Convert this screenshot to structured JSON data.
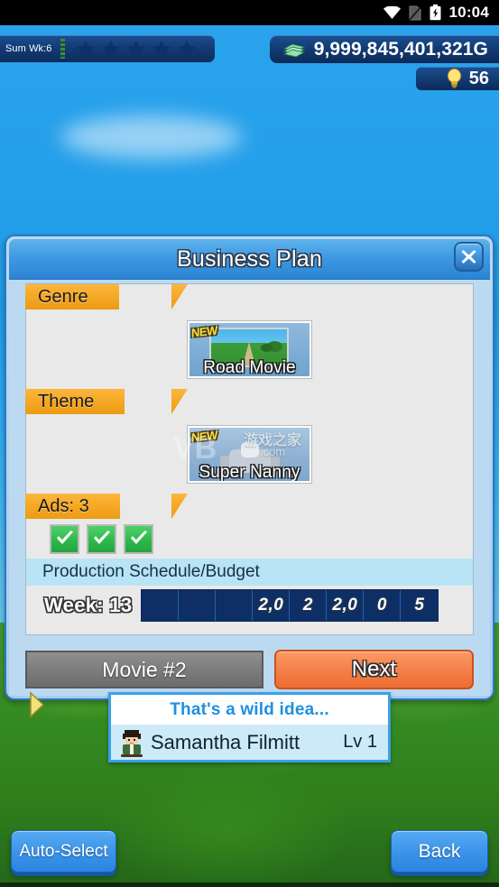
{
  "status_bar": {
    "time": "10:04",
    "icons": [
      "wifi-icon",
      "sim-card-icon",
      "battery-charging-icon"
    ]
  },
  "hud": {
    "week_badge": "Sum Wk:6",
    "star_count": 5,
    "stars_filled": 0,
    "money": "9,999,845,401,321G",
    "money_icon": "cash-stack-icon",
    "research_points": "56",
    "research_icon": "light-bulb-icon"
  },
  "dialog": {
    "title": "Business Plan",
    "close_icon": "close-x-icon",
    "sections": [
      {
        "label": "Genre",
        "card": {
          "badge": "NEW",
          "name": "Road Movie",
          "art": "road-movie-thumbnail"
        }
      },
      {
        "label": "Theme",
        "card": {
          "badge": "NEW",
          "name": "Super Nanny",
          "art": "super-nanny-thumbnail"
        }
      }
    ],
    "ads": {
      "label": "Ads: 3",
      "checked_count": 3,
      "checkbox_icon": "check-mark-icon"
    },
    "schedule": {
      "header": "Production Schedule/Budget",
      "week_label": "Week: 13",
      "budget_cells": [
        "",
        "",
        "",
        "2,0",
        "2",
        "2,0",
        "0",
        "5"
      ],
      "budget_total": "2,022,005"
    },
    "footer": {
      "movie_label": "Movie #2",
      "next_label": "Next"
    },
    "nav_arrow_icons": {
      "left": "triangle-right-icon",
      "right": "triangle-left-icon"
    }
  },
  "character": {
    "quote": "That's a wild idea...",
    "name": "Samantha Filmitt",
    "level": "Lv 1",
    "avatar_icon": "character-portrait-icon"
  },
  "bottom_bar": {
    "auto_select_label": "Auto-Select",
    "back_label": "Back"
  },
  "watermark": {
    "brand": "VB",
    "cn": "游戏之家",
    "tld": ".com"
  },
  "colors": {
    "accent_orange": "#f5a623",
    "next_button": "#f5814a",
    "dialog_title": "#3f9ae2",
    "button_blue": "#3d95ea",
    "check_green": "#2eb84c",
    "budget_navy": "#0d2f66"
  }
}
